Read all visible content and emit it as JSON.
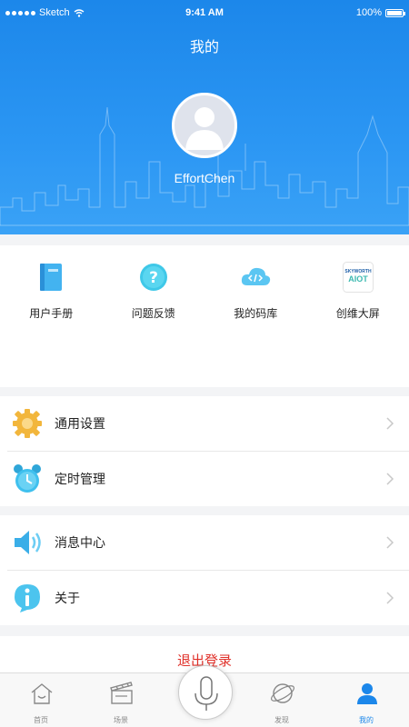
{
  "status_bar": {
    "carrier": "Sketch",
    "time": "9:41 AM",
    "battery": "100%"
  },
  "header": {
    "title": "我的",
    "username": "EffortChen"
  },
  "tools": [
    {
      "label": "用户手册",
      "icon": "book-icon"
    },
    {
      "label": "问题反馈",
      "icon": "question-icon"
    },
    {
      "label": "我的码库",
      "icon": "cloud-code-icon"
    },
    {
      "label": "创维大屏",
      "icon": "skyworth-logo",
      "logo_text": "SKYWORTH",
      "logo_sub": "AIOT"
    }
  ],
  "settings_group": [
    {
      "label": "通用设置",
      "icon": "gear-icon"
    },
    {
      "label": "定时管理",
      "icon": "alarm-clock-icon"
    }
  ],
  "info_group": [
    {
      "label": "消息中心",
      "icon": "speaker-icon"
    },
    {
      "label": "关于",
      "icon": "info-icon"
    }
  ],
  "logout_label": "退出登录",
  "tabbar": [
    {
      "label": "首页",
      "icon": "home-icon"
    },
    {
      "label": "场景",
      "icon": "clapper-icon"
    },
    {
      "label": "",
      "icon": "microphone-icon"
    },
    {
      "label": "发现",
      "icon": "planet-icon"
    },
    {
      "label": "我的",
      "icon": "user-icon",
      "active": true
    }
  ],
  "colors": {
    "header_blue": "#1c87ea",
    "logout_red": "#e0312a",
    "active_tab": "#1c87ea"
  }
}
